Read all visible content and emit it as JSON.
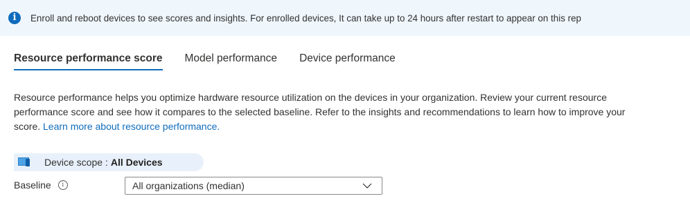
{
  "banner": {
    "icon": "info-icon",
    "text": "Enroll and reboot devices to see scores and insights. For enrolled devices, It can take up to 24 hours after restart to appear on this rep"
  },
  "tabs": [
    {
      "label": "Resource performance score",
      "active": true
    },
    {
      "label": "Model performance",
      "active": false
    },
    {
      "label": "Device performance",
      "active": false
    }
  ],
  "description": {
    "text": "Resource performance helps you optimize hardware resource utilization on the devices in your organization. Review your current resource performance score and see how it compares to the selected baseline. Refer to the insights and recommendations to learn how to improve your score. ",
    "link": "Learn more about resource performance."
  },
  "device_scope": {
    "icon": "devices-icon",
    "label": "Device scope :",
    "value": "All Devices"
  },
  "baseline": {
    "label": "Baseline",
    "info_icon": "info-icon",
    "selected": "All organizations (median)"
  },
  "colors": {
    "accent": "#0f6cbd",
    "banner_bg": "#eff6fc",
    "scope_bg": "#e8f1fb"
  }
}
